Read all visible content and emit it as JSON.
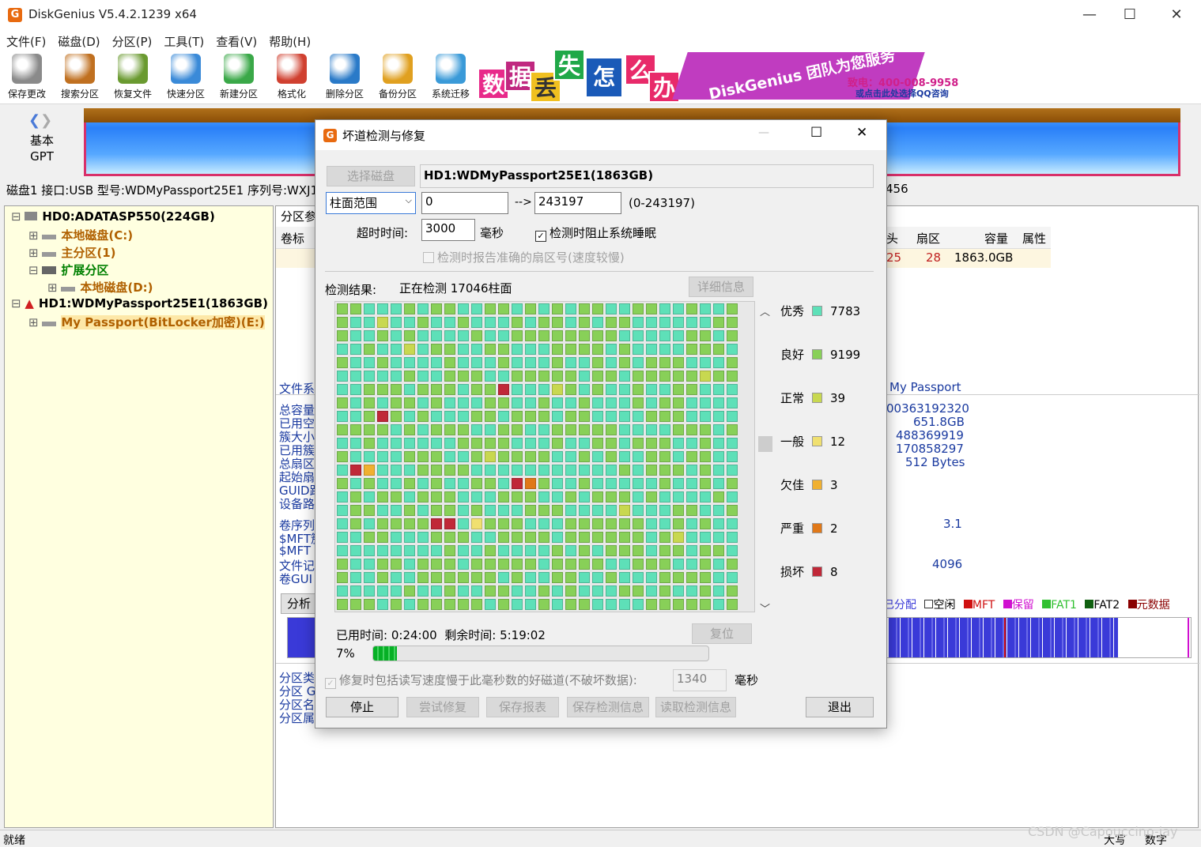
{
  "app": {
    "title": "DiskGenius V5.4.2.1239 x64",
    "icon_letter": "G"
  },
  "window_controls": {
    "minimize": "—",
    "maximize": "☐",
    "close": "✕"
  },
  "menu": [
    "文件(F)",
    "磁盘(D)",
    "分区(P)",
    "工具(T)",
    "查看(V)",
    "帮助(H)"
  ],
  "toolbar": [
    {
      "label": "保存更改",
      "icon": "save-icon",
      "color": "#8a8a8a"
    },
    {
      "label": "搜索分区",
      "icon": "search-icon",
      "color": "#c07020"
    },
    {
      "label": "恢复文件",
      "icon": "recover-icon",
      "color": "#6a9a30"
    },
    {
      "label": "快速分区",
      "icon": "quick-partition-icon",
      "color": "#3a8ad8"
    },
    {
      "label": "新建分区",
      "icon": "new-partition-icon",
      "color": "#3aa848"
    },
    {
      "label": "格式化",
      "icon": "format-icon",
      "color": "#d04030"
    },
    {
      "label": "删除分区",
      "icon": "delete-icon",
      "color": "#2a7ac8"
    },
    {
      "label": "备份分区",
      "icon": "backup-icon",
      "color": "#e0a020"
    },
    {
      "label": "系统迁移",
      "icon": "migrate-icon",
      "color": "#3a9ad8"
    }
  ],
  "banner": {
    "tiles": [
      "数",
      "据",
      "丢",
      "失",
      "怎",
      "么",
      "办"
    ],
    "slogan": "DiskGenius 团队为您服务",
    "phone": "致电：400-008-9958",
    "qq": "或点击此处选择QQ咨询"
  },
  "disk_view": {
    "mode_line1": "基本",
    "mode_line2": "GPT"
  },
  "disk_info": "磁盘1 接口:USB  型号:WDMyPassport25E1  序列号:WXJ1",
  "disk_info_tail": "456",
  "tree": [
    {
      "label": "HD0:ADATASP550(224GB)",
      "cls": "",
      "level": 0
    },
    {
      "label": "本地磁盘(C:)",
      "cls": "orange",
      "level": 1
    },
    {
      "label": "主分区(1)",
      "cls": "orange",
      "level": 1
    },
    {
      "label": "扩展分区",
      "cls": "green",
      "level": 1
    },
    {
      "label": "本地磁盘(D:)",
      "cls": "orange",
      "level": 2
    },
    {
      "label": "HD1:WDMyPassport25E1(1863GB)",
      "cls": "",
      "level": 0
    },
    {
      "label": "My Passport(BitLocker加密)(E:)",
      "cls": "orange",
      "level": 1
    }
  ],
  "right_panel": {
    "tab": "分区参",
    "col_volume": "卷标",
    "col_head": "头",
    "col_sector": "扇区",
    "col_capacity": "容量",
    "col_attr": "属性",
    "row_head": "25",
    "row_sector": "28",
    "row_capacity": "1863.0GB",
    "fs_label": "文件系",
    "volume_name": "My Passport",
    "left_labels": [
      "总容量",
      "已用空",
      "簇大小",
      "已用簇",
      "总扇区",
      "起始扇",
      "GUID路",
      "设备路"
    ],
    "right_values": [
      "00363192320",
      "651.8GB",
      "488369919",
      "170858297",
      "512 Bytes"
    ],
    "left_labels2": [
      "卷序列",
      "$MFT簇",
      "$MFT",
      "文件记",
      "卷GUI"
    ],
    "v31": "3.1",
    "v4096": "4096",
    "analyze_btn": "分析",
    "legend": [
      {
        "name": "已分配",
        "color": "#3a3ad8"
      },
      {
        "name": "空闲",
        "color": "#ffffff"
      },
      {
        "name": "MFT",
        "color": "#d01010"
      },
      {
        "name": "保留",
        "color": "#d010d0"
      },
      {
        "name": "FAT1",
        "color": "#30c030"
      },
      {
        "name": "FAT2",
        "color": "#106010"
      },
      {
        "name": "元数据",
        "color": "#8a0000"
      }
    ],
    "bottom_labels": [
      "分区类",
      "分区 G",
      "分区名",
      "分区属"
    ]
  },
  "status": {
    "left": "就绪",
    "caps": "大写",
    "num": "数字",
    "watermark": "CSDN @Capouccino-jay"
  },
  "dialog": {
    "title": "坏道检测与修复",
    "select_disk_btn": "选择磁盘",
    "disk_name": "HD1:WDMyPassport25E1(1863GB)",
    "range_select": "柱面范围",
    "range_from": "0",
    "arrow": "-->",
    "range_to": "243197",
    "range_hint": "(0-243197)",
    "timeout_label": "超时时间:",
    "timeout_value": "3000",
    "timeout_unit": "毫秒",
    "prevent_sleep": "检测时阻止系统睡眠",
    "report_sectors": "检测时报告准确的扇区号(速度较慢)",
    "result_label": "检测结果:",
    "result_status": "正在检测 17046柱面",
    "detail_btn": "详细信息",
    "elapsed_label": "已用时间:",
    "elapsed": "0:24:00",
    "remain_label": "剩余时间:",
    "remain": "5:19:02",
    "reset_btn": "复位",
    "progress_text": "7%",
    "progress": 0.07,
    "repair_slow": "修复时包括读写速度慢于此毫秒数的好磁道(不破坏数据):",
    "repair_ms": "1340",
    "repair_unit": "毫秒",
    "buttons": {
      "stop": "停止",
      "try_repair": "尝试修复",
      "save_report": "保存报表",
      "save_info": "保存检测信息",
      "load_info": "读取检测信息",
      "exit": "退出"
    },
    "legend": [
      {
        "label": "优秀",
        "count": "7783",
        "color": "#5ee0b8"
      },
      {
        "label": "良好",
        "count": "9199",
        "color": "#88d058"
      },
      {
        "label": "正常",
        "count": "39",
        "color": "#c8d850"
      },
      {
        "label": "一般",
        "count": "12",
        "color": "#f0e070"
      },
      {
        "label": "欠佳",
        "count": "3",
        "color": "#f0b030"
      },
      {
        "label": "严重",
        "count": "2",
        "color": "#e07818"
      },
      {
        "label": "损坏",
        "count": "8",
        "color": "#c02838"
      }
    ]
  }
}
